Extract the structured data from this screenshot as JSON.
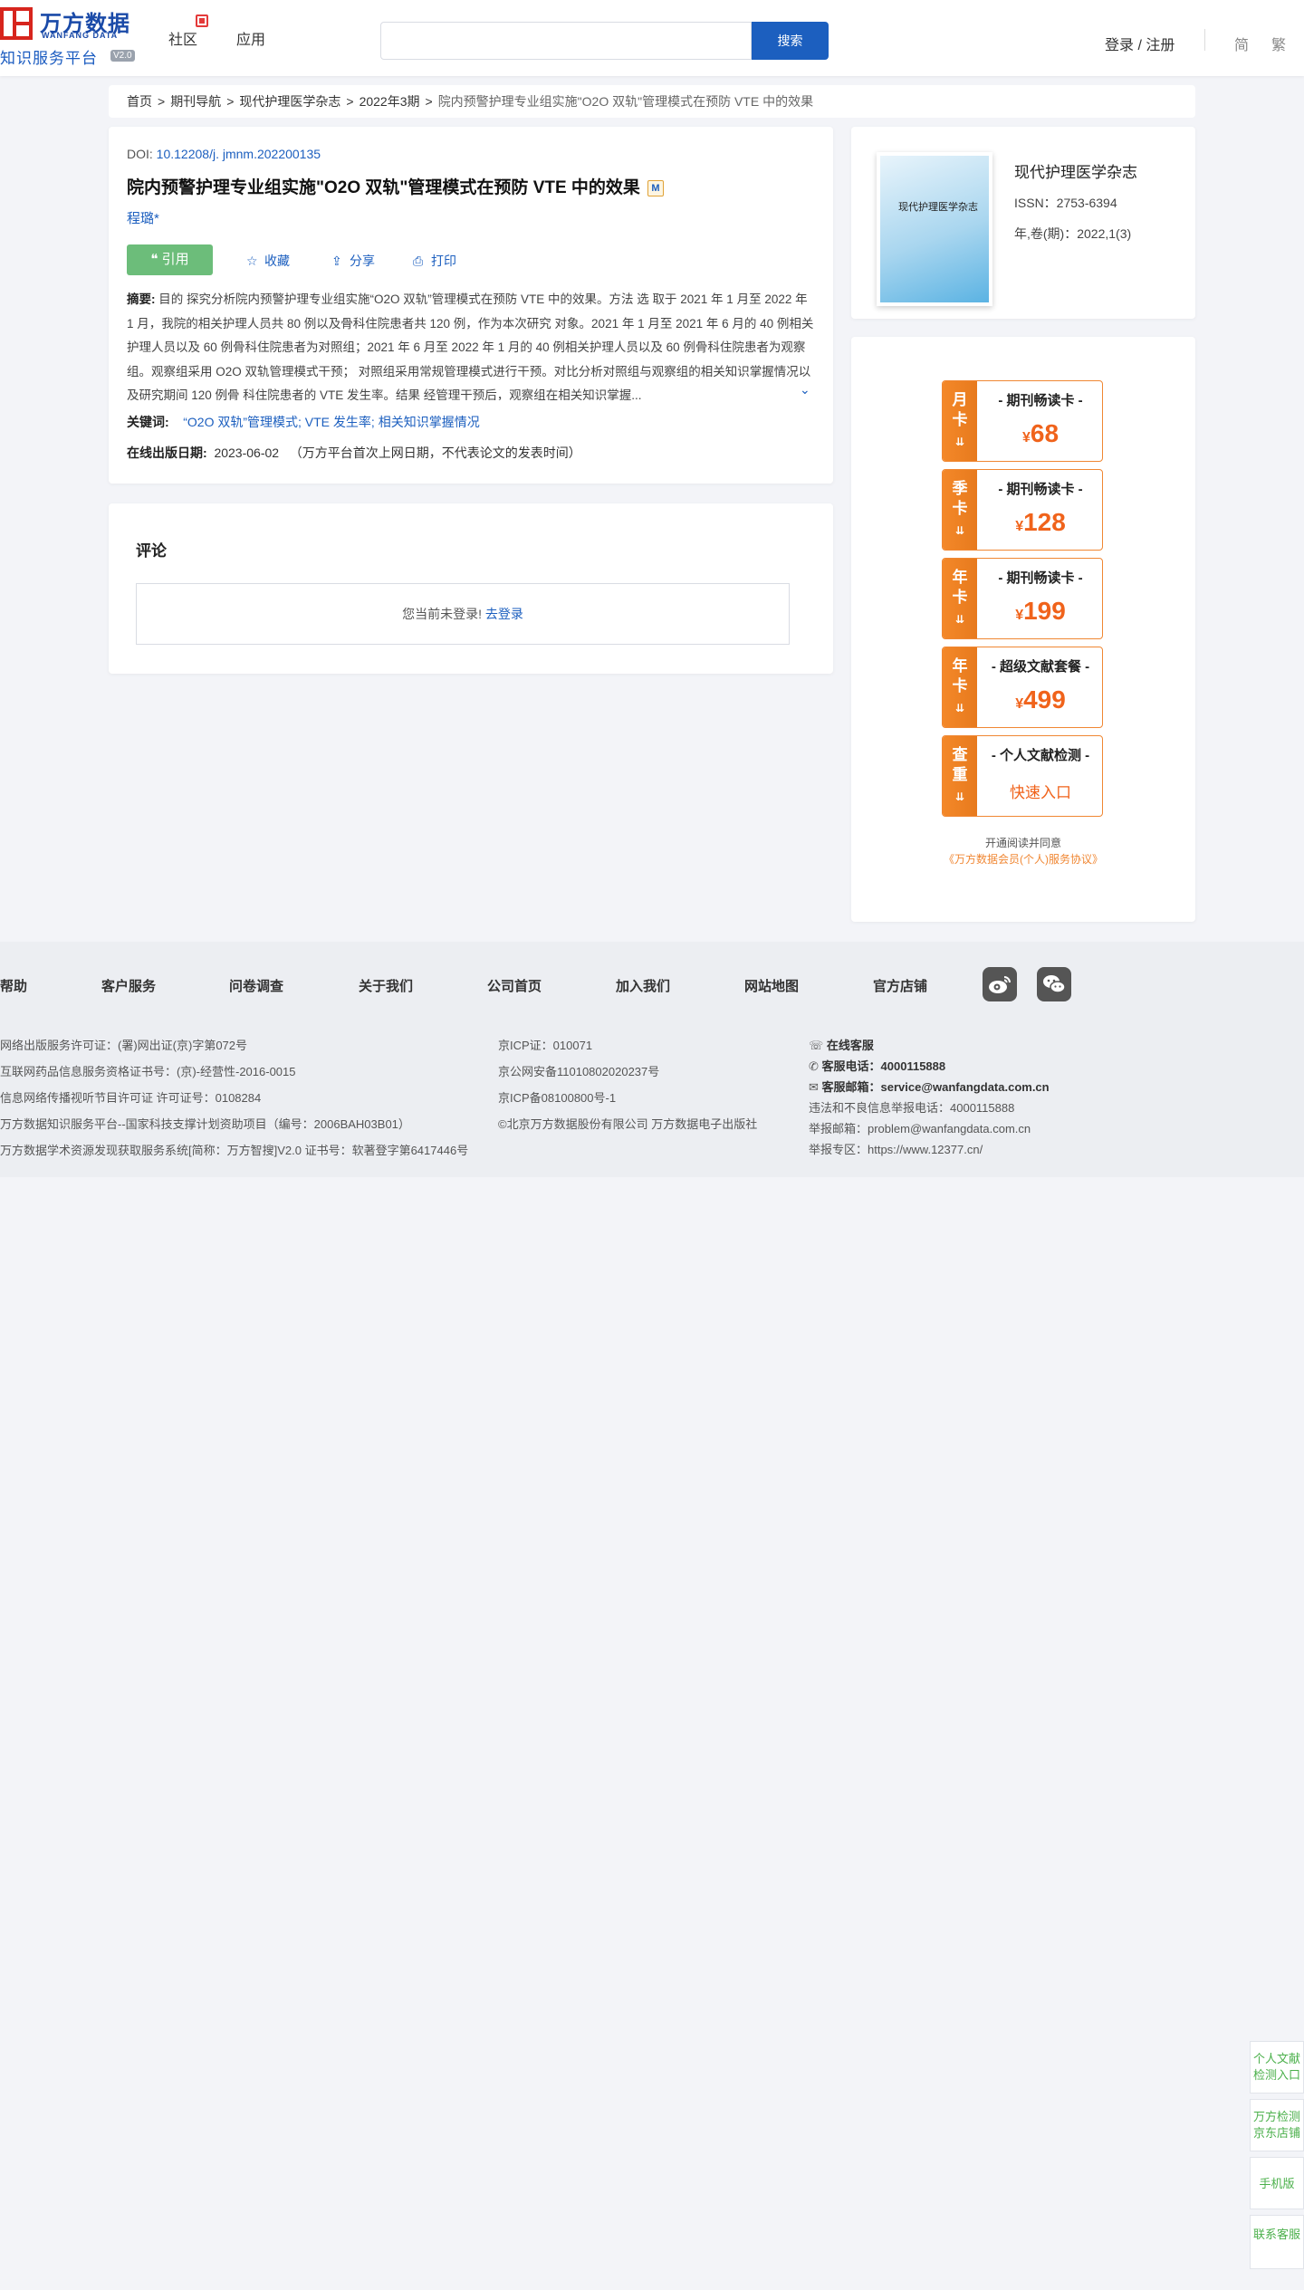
{
  "header": {
    "logo_cn": "万方数据",
    "logo_en": "WANFANG DATA",
    "logo_sub": "知识服务平台",
    "logo_ver": "V2.0",
    "nav": [
      "社区",
      "应用"
    ],
    "search_placeholder": "",
    "search_button": "搜索",
    "login": "登录 / 注册",
    "lang_simplified": "简",
    "lang_traditional": "繁"
  },
  "breadcrumb": {
    "items": [
      "首页",
      "期刊导航",
      "现代护理医学杂志",
      "2022年3期"
    ],
    "current": "院内预警护理专业组实施\"O2O 双轨\"管理模式在预防 VTE 中的效果"
  },
  "article": {
    "doi_label": "DOI: ",
    "doi": "10.12208/j. jmnm.202200135",
    "title": "院内预警护理专业组实施\"O2O 双轨\"管理模式在预防 VTE 中的效果",
    "m_badge": "M",
    "author": "程璐*",
    "cite": "引用",
    "favorite": "收藏",
    "share": "分享",
    "print": "打印",
    "abstract_label": "摘要:",
    "abstract": "目的 探究分析院内预警护理专业组实施“O2O 双轨”管理模式在预防 VTE 中的效果。方法 选 取于 2021 年 1 月至 2022 年 1 月，我院的相关护理人员共 80 例以及骨科住院患者共 120 例，作为本次研究 对象。2021 年 1 月至 2021 年 6 月的 40 例相关护理人员以及 60 例骨科住院患者为对照组；2021 年 6 月至 2022 年 1 月的 40 例相关护理人员以及 60 例骨科住院患者为观察组。观察组采用 O2O 双轨管理模式干预； 对照组采用常规管理模式进行干预。对比分析对照组与观察组的相关知识掌握情况以及研究期间 120 例骨 科住院患者的 VTE 发生率。结果 经管理干预后，观察组在相关知识掌握...",
    "keywords_label": "关键词:",
    "keywords": [
      "“O2O 双轨”管理模式",
      "VTE 发生率",
      "相关知识掌握情况"
    ],
    "date_label": "在线出版日期:",
    "date": "2023-06-02",
    "date_note": "（万方平台首次上网日期，不代表论文的发表时间）"
  },
  "comment": {
    "title": "评论",
    "notice": "您当前未登录!",
    "login_link": "去登录"
  },
  "journal": {
    "cover_text": "现代护理医学杂志",
    "name": "现代护理医学杂志",
    "issn": "ISSN：2753-6394",
    "volume": "年,卷(期)：2022,1(3)"
  },
  "pricing": {
    "cards": [
      {
        "tab": [
          "月",
          "卡"
        ],
        "name": "- 期刊畅读卡 -",
        "currency": "¥",
        "price": "68"
      },
      {
        "tab": [
          "季",
          "卡"
        ],
        "name": "- 期刊畅读卡 -",
        "currency": "¥",
        "price": "128"
      },
      {
        "tab": [
          "年",
          "卡"
        ],
        "name": "- 期刊畅读卡 -",
        "currency": "¥",
        "price": "199"
      },
      {
        "tab": [
          "年",
          "卡"
        ],
        "name": "- 超级文献套餐 -",
        "currency": "¥",
        "price": "499"
      },
      {
        "tab": [
          "查",
          "重"
        ],
        "name": "- 个人文献检测 -",
        "quick": "快速入口"
      }
    ],
    "agree_text": "开通阅读并同意",
    "agree_link": "《万方数据会员(个人)服务协议》"
  },
  "footer": {
    "links": [
      "帮助",
      "客户服务",
      "问卷调查",
      "关于我们",
      "公司首页",
      "加入我们",
      "网站地图",
      "官方店铺"
    ],
    "col1": [
      "网络出版服务许可证：(署)网出证(京)字第072号",
      "互联网药品信息服务资格证书号：(京)-经营性-2016-0015",
      "信息网络传播视听节目许可证 许可证号：0108284",
      "万方数据知识服务平台--国家科技支撑计划资助项目（编号：2006BAH03B01）",
      "万方数据学术资源发现获取服务系统[简称：万方智搜]V2.0 证书号：软著登字第6417446号"
    ],
    "col2": [
      "京ICP证：010071",
      "京公网安备11010802020237号",
      "京ICP备08100800号-1",
      "©北京万方数据股份有限公司 万方数据电子出版社"
    ],
    "online_service": "在线客服",
    "phone_label": "客服电话：",
    "phone": "4000115888",
    "email_label": "客服邮箱：",
    "email": "service@wanfangdata.com.cn",
    "report_phone": "违法和不良信息举报电话：4000115888",
    "report_email": "举报邮箱：problem@wanfangdata.com.cn",
    "report_zone": "举报专区：https://www.12377.cn/"
  },
  "side": {
    "items": [
      "个人文献检测入口",
      "万方检测京东店铺",
      "手机版",
      "联系客服"
    ]
  }
}
